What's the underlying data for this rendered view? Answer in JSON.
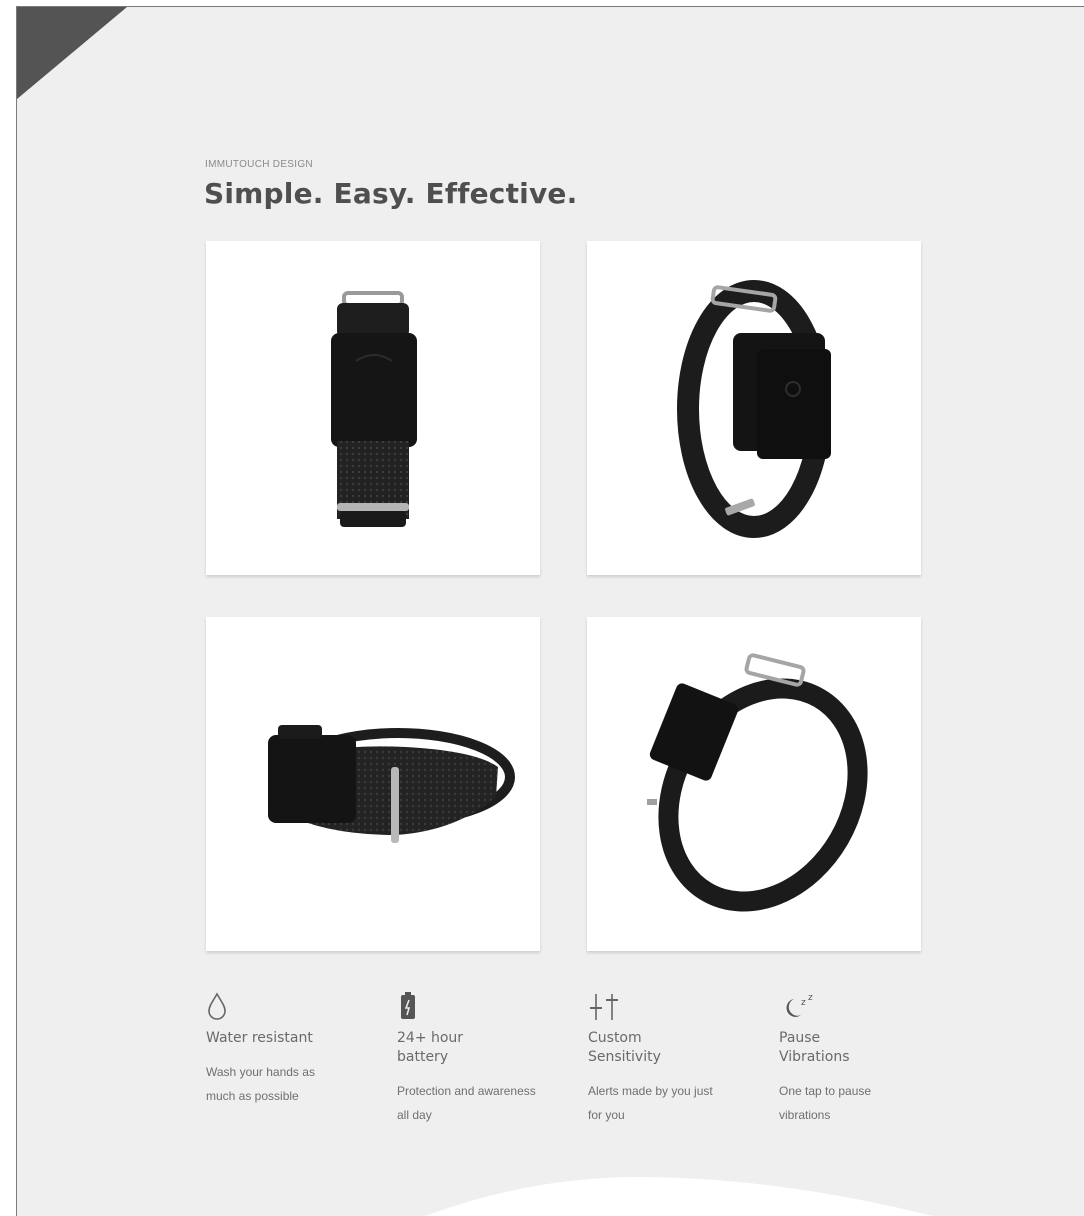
{
  "section": {
    "eyebrow": "IMMUTOUCH DESIGN",
    "headline": "Simple. Easy. Effective."
  },
  "gallery": [
    {
      "icon": "wristband-front-view"
    },
    {
      "icon": "wristband-angled-view"
    },
    {
      "icon": "wristband-side-view"
    },
    {
      "icon": "wristband-perspective-view"
    }
  ],
  "features": [
    {
      "icon": "water-drop-icon",
      "title": "Water resistant",
      "desc": "Wash your hands as much as possible"
    },
    {
      "icon": "battery-icon",
      "title": "24+ hour battery",
      "desc": "Protection and awareness all day"
    },
    {
      "icon": "sliders-icon",
      "title": "Custom Sensitivity",
      "desc": "Alerts made by you just for you"
    },
    {
      "icon": "moon-zz-icon",
      "title": "Pause Vibrations",
      "desc": "One tap to pause vibrations"
    }
  ],
  "colors": {
    "background": "#efefef",
    "card": "#ffffff",
    "headline": "#4f4f4f",
    "band": "#1c1c1c"
  }
}
